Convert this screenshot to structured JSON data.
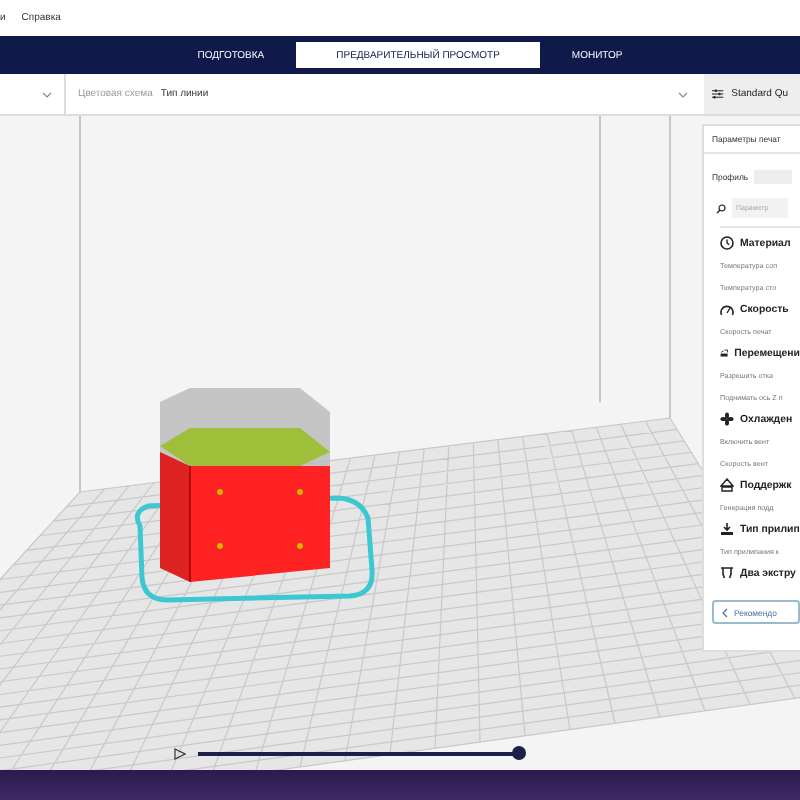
{
  "menu": [
    "и",
    "Справка"
  ],
  "stages": [
    {
      "label": "ПОДГОТОВКА",
      "selected": false
    },
    {
      "label": "ПРЕДВАРИТЕЛЬНЫЙ ПРОСМОТР",
      "selected": true
    },
    {
      "label": "МОНИТОР",
      "selected": false
    }
  ],
  "toolbar": {
    "color_scheme_label": "Цветовая схема",
    "color_scheme_value": "Тип линии",
    "profile_button": "Standard Qu"
  },
  "settings_panel": {
    "title": "Параметры печат",
    "profile_label": "Профиль",
    "search_placeholder": "Параметр",
    "sections": [
      {
        "kind": "material",
        "title": "Материал",
        "items": [
          "Температура соп",
          "Температура сто"
        ]
      },
      {
        "kind": "speed",
        "title": "Скорость",
        "items": [
          "Скорость печат"
        ]
      },
      {
        "kind": "travel",
        "title": "Перемещени",
        "items": [
          "Разрешить отка",
          "Поднимать ось Z п"
        ]
      },
      {
        "kind": "cooling",
        "title": "Охлажден",
        "items": [
          "Включить вент",
          "Скорость вент"
        ]
      },
      {
        "kind": "support",
        "title": "Поддержк",
        "items": [
          "Генерация подд"
        ]
      },
      {
        "kind": "adhesion",
        "title": "Тип прилип",
        "items": [
          "Тип прилипания к"
        ]
      },
      {
        "kind": "extruders",
        "title": "Два экстру"
      }
    ],
    "recommended_button": "Рекомендо"
  },
  "layer_slider": {
    "level": 1
  }
}
